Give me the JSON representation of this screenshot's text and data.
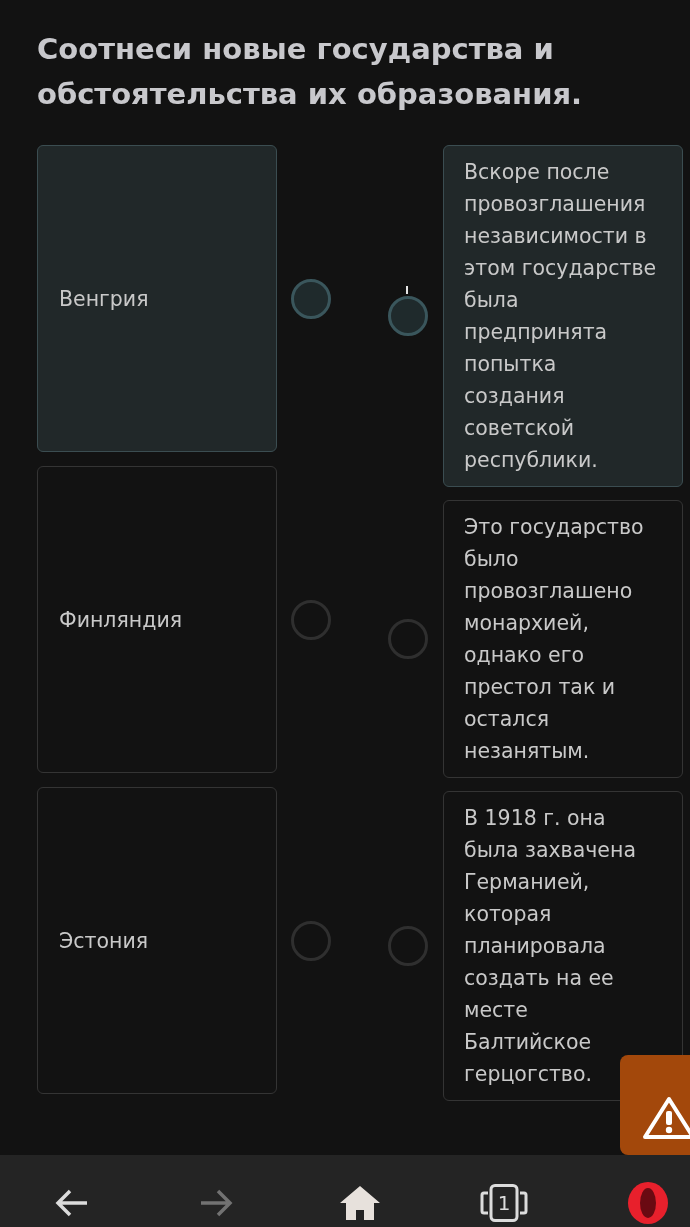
{
  "title": "Соотнеси новые государства и обстоятельства их образования.",
  "left_items": [
    {
      "label": "Венгрия",
      "selected": true
    },
    {
      "label": "Финляндия",
      "selected": false
    },
    {
      "label": "Эстония",
      "selected": false
    }
  ],
  "right_items": [
    {
      "text": "Вскоре после провозглашения независимости в этом государстве была предпринята попытка создания советской республики.",
      "selected": true,
      "cursor_mark": true
    },
    {
      "text": "Это государство было провозглашено монархией, однако его престол так и остался незанятым.",
      "selected": false,
      "cursor_mark": false
    },
    {
      "text": "В 1918 г. она была захвачена Германией, которая планировала создать на ее месте Балтийское герцогство.",
      "selected": false,
      "cursor_mark": false
    }
  ],
  "browser_bar": {
    "buttons": [
      {
        "kind": "back",
        "disabled": false
      },
      {
        "kind": "forward",
        "disabled": true
      },
      {
        "kind": "home",
        "disabled": false
      },
      {
        "kind": "tabs",
        "count": "1",
        "disabled": false
      },
      {
        "kind": "opera",
        "disabled": false
      }
    ]
  }
}
